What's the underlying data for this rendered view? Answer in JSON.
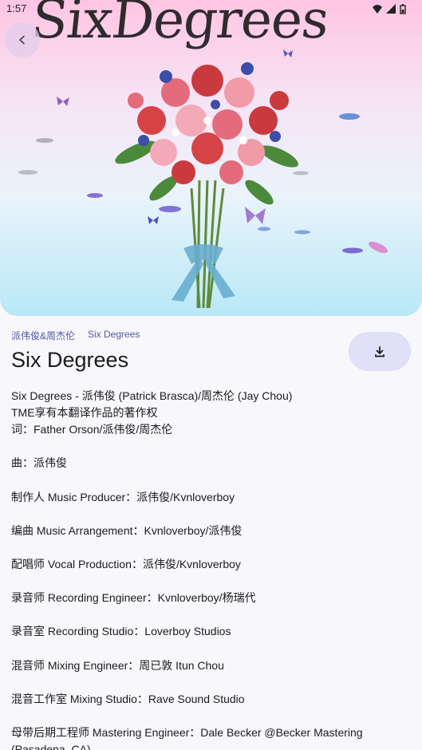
{
  "status_bar": {
    "time": "1:57"
  },
  "header": {
    "cover_title": "SixDegrees",
    "back_icon": "chevron-left-icon"
  },
  "song": {
    "artists": "派伟俊&周杰伦",
    "album": "Six Degrees",
    "title": "Six Degrees",
    "download_icon": "download-icon"
  },
  "lyrics": [
    "Six Degrees - 派伟俊 (Patrick Brasca)/周杰伦 (Jay Chou)",
    "TME享有本翻译作品的著作权",
    "词：Father Orson/派伟俊/周杰伦",
    "",
    "曲：派伟俊",
    "",
    "制作人 Music Producer：派伟俊/Kvnloverboy",
    "",
    "编曲 Music Arrangement：Kvnloverboy/派伟俊",
    "",
    "配唱师 Vocal Production：派伟俊/Kvnloverboy",
    "",
    "录音师 Recording Engineer：Kvnloverboy/杨瑞代",
    "",
    "录音室 Recording Studio：Loverboy Studios",
    "",
    "混音师 Mixing Engineer：周已敦 Itun Chou",
    "",
    "混音工作室 Mixing Studio：Rave Sound Studio",
    "",
    "母带后期工程师 Mastering Engineer：Dale Becker @Becker Mastering (Pasadena, CA)"
  ],
  "colors": {
    "accent": "#55579b",
    "button_bg": "#e0e0f7",
    "page_bg": "#f7f7fc"
  }
}
